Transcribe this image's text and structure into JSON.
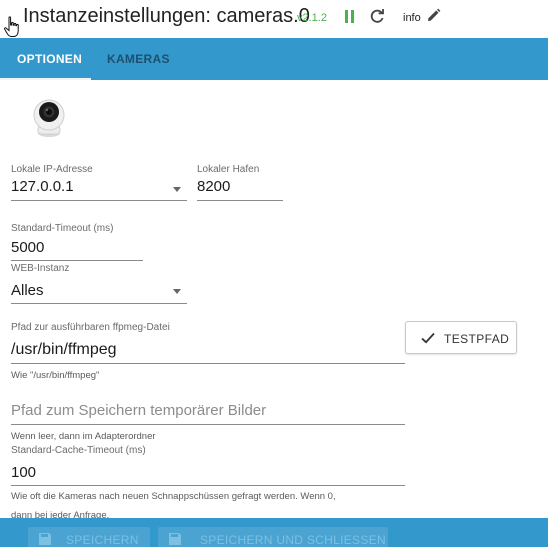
{
  "header": {
    "title": "Instanzeinstellungen: cameras.0",
    "version": "v2.1.2",
    "info_label": "info",
    "icons": [
      "hand-cursor-icon",
      "pause-icon",
      "reload-icon",
      "pencil-icon"
    ]
  },
  "tabs": [
    {
      "label": "OPTIONEN",
      "active": true
    },
    {
      "label": "KAMERAS",
      "active": false
    }
  ],
  "form": {
    "local_ip": {
      "label": "Lokale IP-Adresse",
      "value": "127.0.0.1"
    },
    "local_port": {
      "label": "Lokaler Hafen",
      "value": "8200"
    },
    "timeout": {
      "label": "Standard-Timeout (ms)",
      "value": "5000"
    },
    "web_instance": {
      "label": "WEB-Instanz",
      "value": "Alles"
    },
    "ffmpeg_path": {
      "label": "Pfad zur ausführbaren ffpmeg-Datei",
      "value": "/usr/bin/ffmpeg",
      "help": "Wie \"/usr/bin/ffmpeg\""
    },
    "test_button": "TESTPFAD",
    "temp_path": {
      "placeholder": "Pfad zum Speichern temporärer Bilder",
      "help": "Wenn leer, dann im Adapterordner"
    },
    "cache_timeout": {
      "label": "Standard-Cache-Timeout (ms)",
      "value": "100",
      "help_line1": "Wie oft die Kameras nach neuen Schnappschüssen gefragt werden. Wenn 0,",
      "help_line2": "dann bei jeder Anfrage."
    }
  },
  "footer": {
    "save_label": "SPEICHERN",
    "save_close_label": "SPEICHERN UND SCHLIESSEN"
  },
  "colors": {
    "accent": "#3399cc",
    "version_green": "#4caf50"
  }
}
